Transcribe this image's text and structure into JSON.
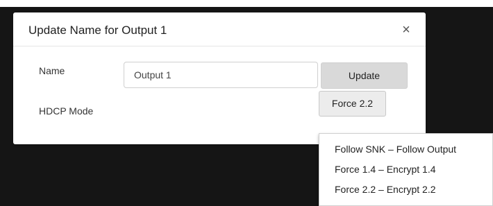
{
  "dialog": {
    "title": "Update Name for Output 1",
    "close_glyph": "×"
  },
  "form": {
    "name_label": "Name",
    "name_value": "Output 1",
    "update_label": "Update",
    "hdcp_label": "HDCP Mode",
    "hdcp_selected": "Force 2.2"
  },
  "hdcp_options": [
    "Follow SNK – Follow Output",
    "Force 1.4 – Encrypt 1.4",
    "Force 2.2 – Encrypt 2.2"
  ]
}
